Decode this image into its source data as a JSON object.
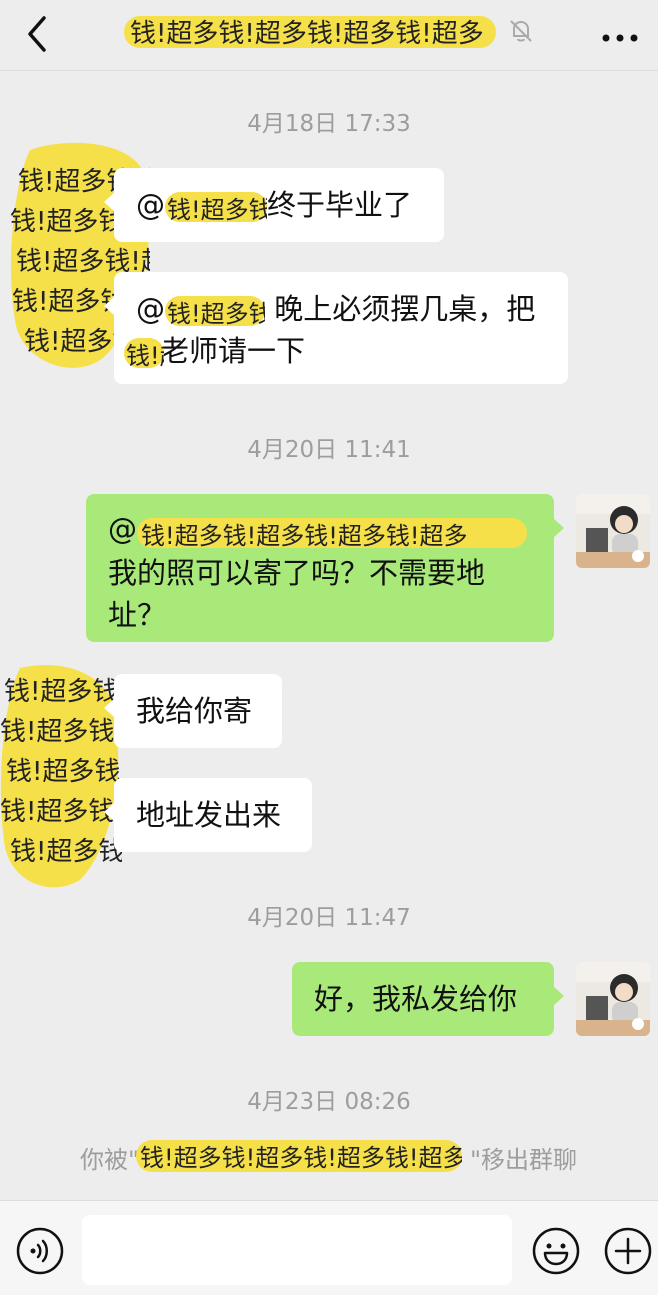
{
  "header": {
    "back_icon": "chevron-left-icon",
    "title_redacted_text": "钱!超多钱!超多钱!超多钱!超多",
    "mute_icon": "bell-off-icon",
    "more_icon": "ellipsis-icon"
  },
  "messages": [
    {
      "type": "time",
      "text": "4月18日 17:33"
    },
    {
      "type": "left",
      "mention": "@",
      "text": "终于毕业了"
    },
    {
      "type": "left",
      "mention": "@",
      "text_line1": "晚上必须摆几桌，把",
      "text_line2": "老师请一下"
    },
    {
      "type": "time",
      "text": "4月20日 11:41"
    },
    {
      "type": "right",
      "mention": "@",
      "text_line1": "我的照可以寄了吗？不需要地",
      "text_line2": "址？"
    },
    {
      "type": "left",
      "text": "我给你寄"
    },
    {
      "type": "left",
      "text": "地址发出来"
    },
    {
      "type": "time",
      "text": "4月20日 11:47"
    },
    {
      "type": "right",
      "text": "好，我私发给你"
    },
    {
      "type": "time",
      "text": "4月23日 08:26"
    }
  ],
  "system_notice": {
    "prefix": "你被\"",
    "suffix": "\"移出群聊"
  },
  "redaction": {
    "text": "钱!超多钱!超多钱!超多钱!超多",
    "color": "#f5e04a"
  },
  "footer": {
    "voice_icon": "voice-icon",
    "emoji_icon": "smiley-icon",
    "plus_icon": "plus-circle-icon"
  },
  "colors": {
    "background": "#ededed",
    "bubble_right": "#a9e97a",
    "bubble_left": "#ffffff",
    "timestamp": "#9d9d9d"
  }
}
